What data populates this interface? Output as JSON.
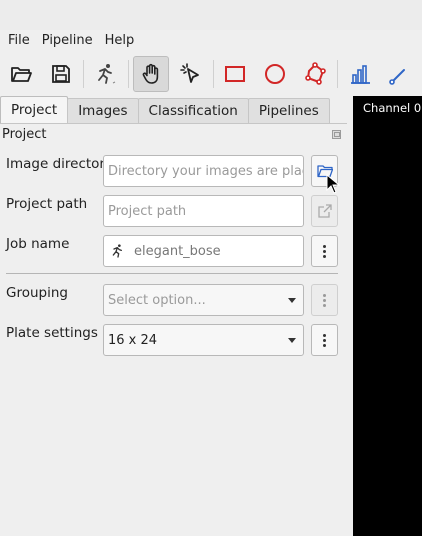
{
  "menu": [
    "File",
    "Pipeline",
    "Help"
  ],
  "toolbar": {
    "tools": [
      "open-folder-icon",
      "save-icon",
      "run-icon",
      "pan-hand-icon",
      "select-pointer-icon",
      "rectangle-icon",
      "ellipse-icon",
      "polygon-icon",
      "bar-chart-icon",
      "edit-line-icon"
    ],
    "active_tool": "pan-hand-icon",
    "accent_color": "#d22727",
    "chart_color": "#2f66c7"
  },
  "tabs": [
    "Project",
    "Images",
    "Classification",
    "Pipelines"
  ],
  "active_tab": "Project",
  "pane": {
    "title": "Project",
    "image_directory": {
      "label": "Image directory",
      "placeholder": "Directory your images are place..."
    },
    "project_path": {
      "label": "Project path",
      "placeholder": "Project path"
    },
    "job_name": {
      "label": "Job name",
      "value": "elegant_bose"
    },
    "grouping": {
      "label": "Grouping",
      "placeholder": "Select option..."
    },
    "plate_settings": {
      "label": "Plate settings",
      "value": "16 x 24"
    }
  },
  "viewer": {
    "channel_label": "Channel 0"
  }
}
